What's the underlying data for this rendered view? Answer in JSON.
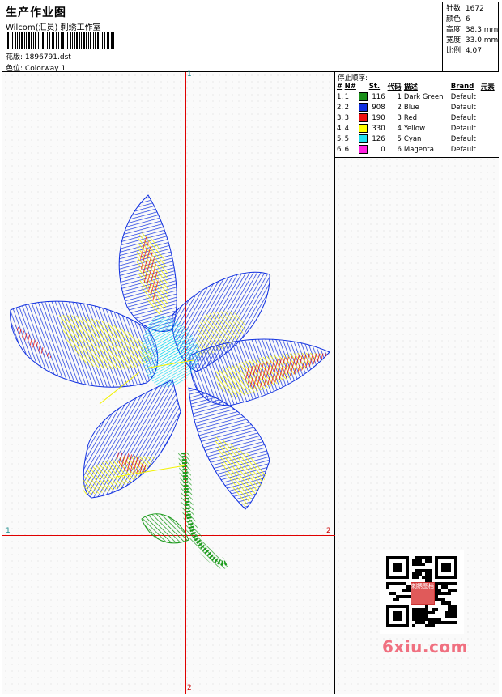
{
  "header": {
    "title": "生产作业图",
    "company": "Wilcom(汇员) 刺绣工作室",
    "design_label": "花版:",
    "design_file": "1896791.dst",
    "colorway_label": "色位:",
    "colorway": "Colorway 1"
  },
  "stats": {
    "stitches": "针数: 1672",
    "colors": "颜色: 6",
    "height": "高度: 38.3 mm",
    "width": "宽度: 33.0 mm",
    "scale": "比例: 4.07"
  },
  "axes": {
    "top": "1",
    "left": "1",
    "right": "2",
    "bottom": "2"
  },
  "stop_sequence": {
    "title": "停止顺序:",
    "headers": [
      "#",
      "N#",
      "St.",
      "代码",
      "描述",
      "Brand",
      "元素"
    ],
    "rows": [
      {
        "idx": "1.",
        "n": "1",
        "color": "#1a8f1a",
        "st": "116",
        "code": "1",
        "desc": "Dark Green",
        "brand": "Default"
      },
      {
        "idx": "2.",
        "n": "2",
        "color": "#1030e0",
        "st": "908",
        "code": "2",
        "desc": "Blue",
        "brand": "Default"
      },
      {
        "idx": "3.",
        "n": "3",
        "color": "#ee1010",
        "st": "190",
        "code": "3",
        "desc": "Red",
        "brand": "Default"
      },
      {
        "idx": "4.",
        "n": "4",
        "color": "#ffff00",
        "st": "330",
        "code": "4",
        "desc": "Yellow",
        "brand": "Default"
      },
      {
        "idx": "5.",
        "n": "5",
        "color": "#20e0f0",
        "st": "126",
        "code": "5",
        "desc": "Cyan",
        "brand": "Default"
      },
      {
        "idx": "6.",
        "n": "6",
        "color": "#ff20e0",
        "st": "0",
        "code": "6",
        "desc": "Magenta",
        "brand": "Default"
      }
    ]
  },
  "watermark": "6xiu.com",
  "qr_badge": "刺绣图档"
}
